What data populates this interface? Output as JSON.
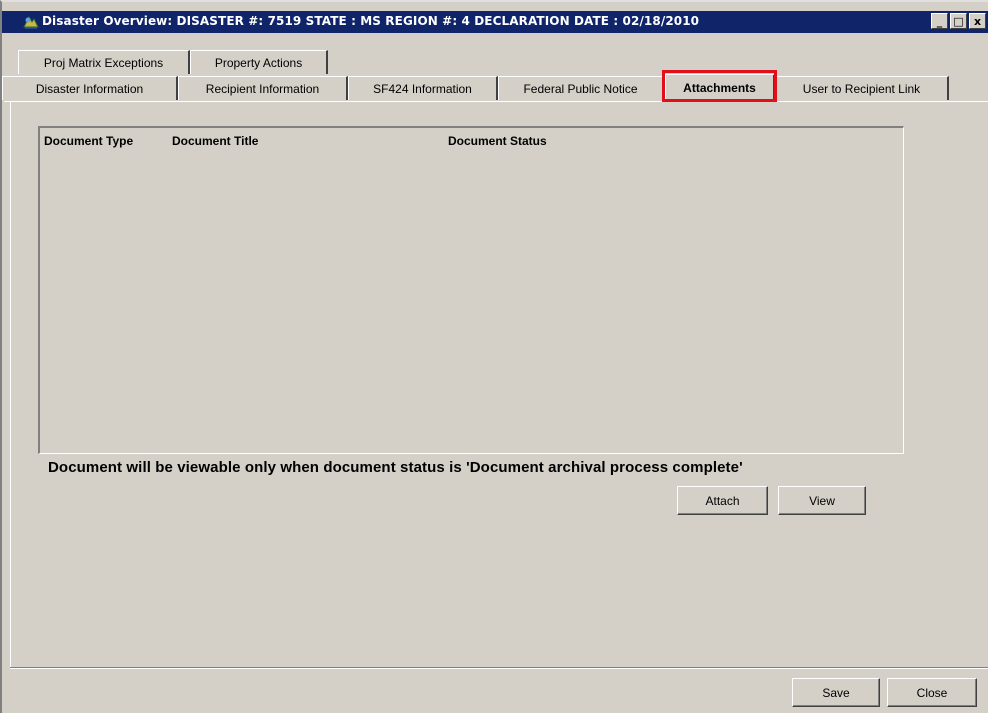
{
  "window": {
    "title": "Disaster Overview:  DISASTER #: 7519  STATE : MS  REGION #: 4  DECLARATION DATE : 02/18/2010",
    "controls": {
      "minimize": "_",
      "maximize": "□",
      "close": "x"
    }
  },
  "tabs": {
    "row1": [
      {
        "label": "Proj Matrix Exceptions"
      },
      {
        "label": "Property Actions"
      }
    ],
    "row2": [
      {
        "label": "Disaster Information"
      },
      {
        "label": "Recipient  Information"
      },
      {
        "label": "SF424  Information"
      },
      {
        "label": "Federal Public Notice"
      },
      {
        "label": "Attachments",
        "active": true
      },
      {
        "label": "User to Recipient Link"
      }
    ]
  },
  "attachments": {
    "columns": [
      "Document Type",
      "Document Title",
      "Document Status"
    ],
    "rows": [],
    "note": "Document will be viewable only when document status is 'Document archival process complete'",
    "attach_label": "Attach",
    "view_label": "View"
  },
  "footer": {
    "save_label": "Save",
    "close_label": "Close"
  },
  "colors": {
    "titlebar": "#10246a",
    "highlight": "#e0101a",
    "face": "#d4d0c8"
  }
}
